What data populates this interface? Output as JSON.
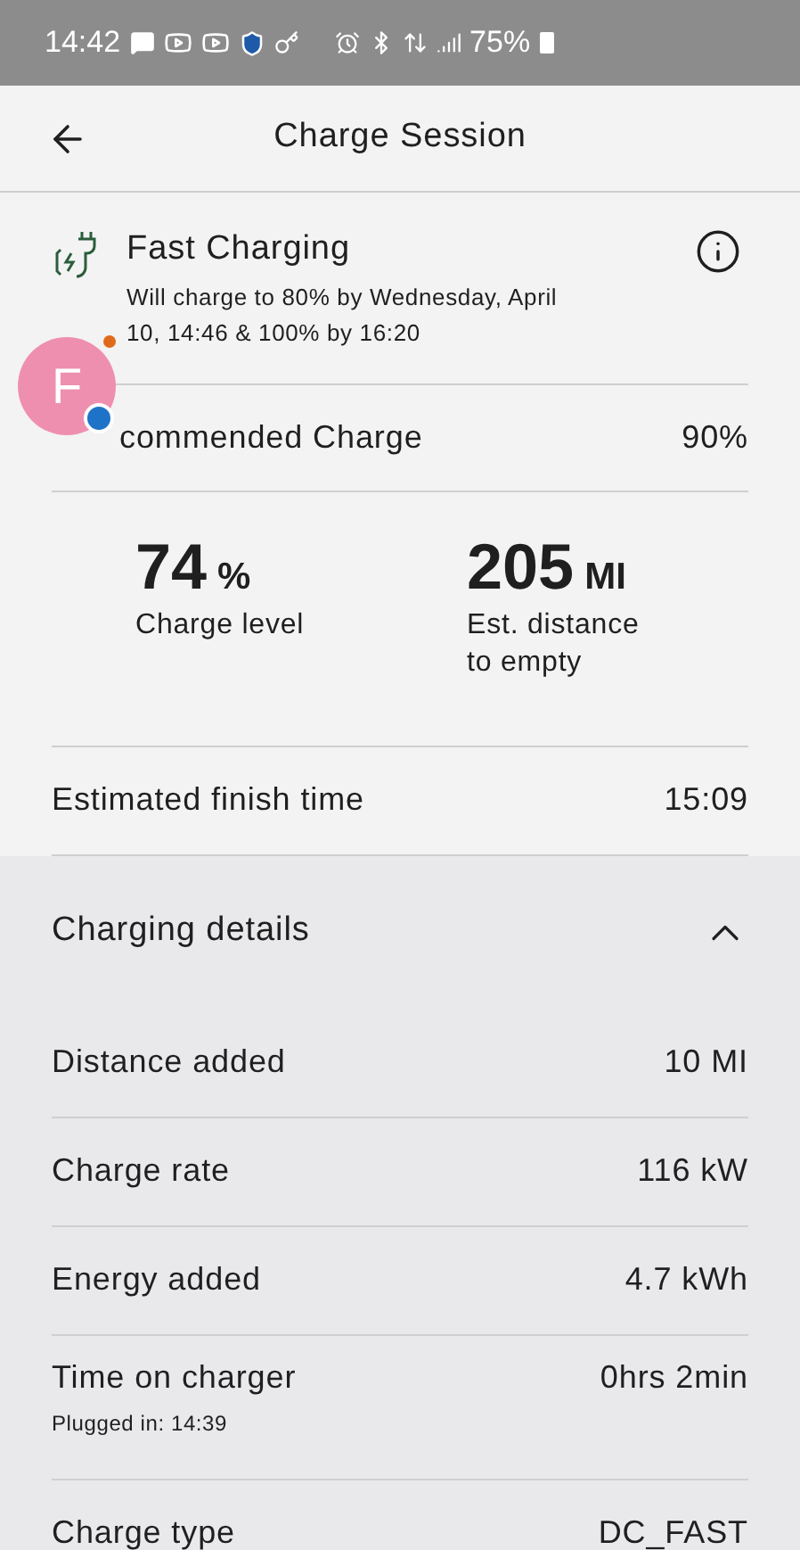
{
  "status_bar": {
    "time": "14:42",
    "battery": "75%"
  },
  "header": {
    "title": "Charge Session"
  },
  "charging_status": {
    "title": "Fast Charging",
    "description": "Will charge to 80% by Wednesday, April 10, 14:46 & 100% by 16:20"
  },
  "chat_bubble": {
    "letter": "F"
  },
  "recommended": {
    "label": "commended Charge",
    "value": "90%"
  },
  "stats": [
    {
      "value": "74",
      "unit": "%",
      "label": "Charge level"
    },
    {
      "value": "205",
      "unit": "MI",
      "label": "Est. distance to empty"
    }
  ],
  "finish": {
    "label": "Estimated finish time",
    "value": "15:09"
  },
  "details": {
    "title": "Charging details",
    "expanded": true,
    "rows": [
      {
        "label": "Distance added",
        "value": "10 MI"
      },
      {
        "label": "Charge rate",
        "value": "116 kW"
      },
      {
        "label": "Energy added",
        "value": "4.7 kWh"
      },
      {
        "label": "Time on charger",
        "value": "0hrs 2min",
        "note": "Plugged in: 14:39"
      },
      {
        "label": "Charge type",
        "value": "DC_FAST"
      }
    ]
  }
}
